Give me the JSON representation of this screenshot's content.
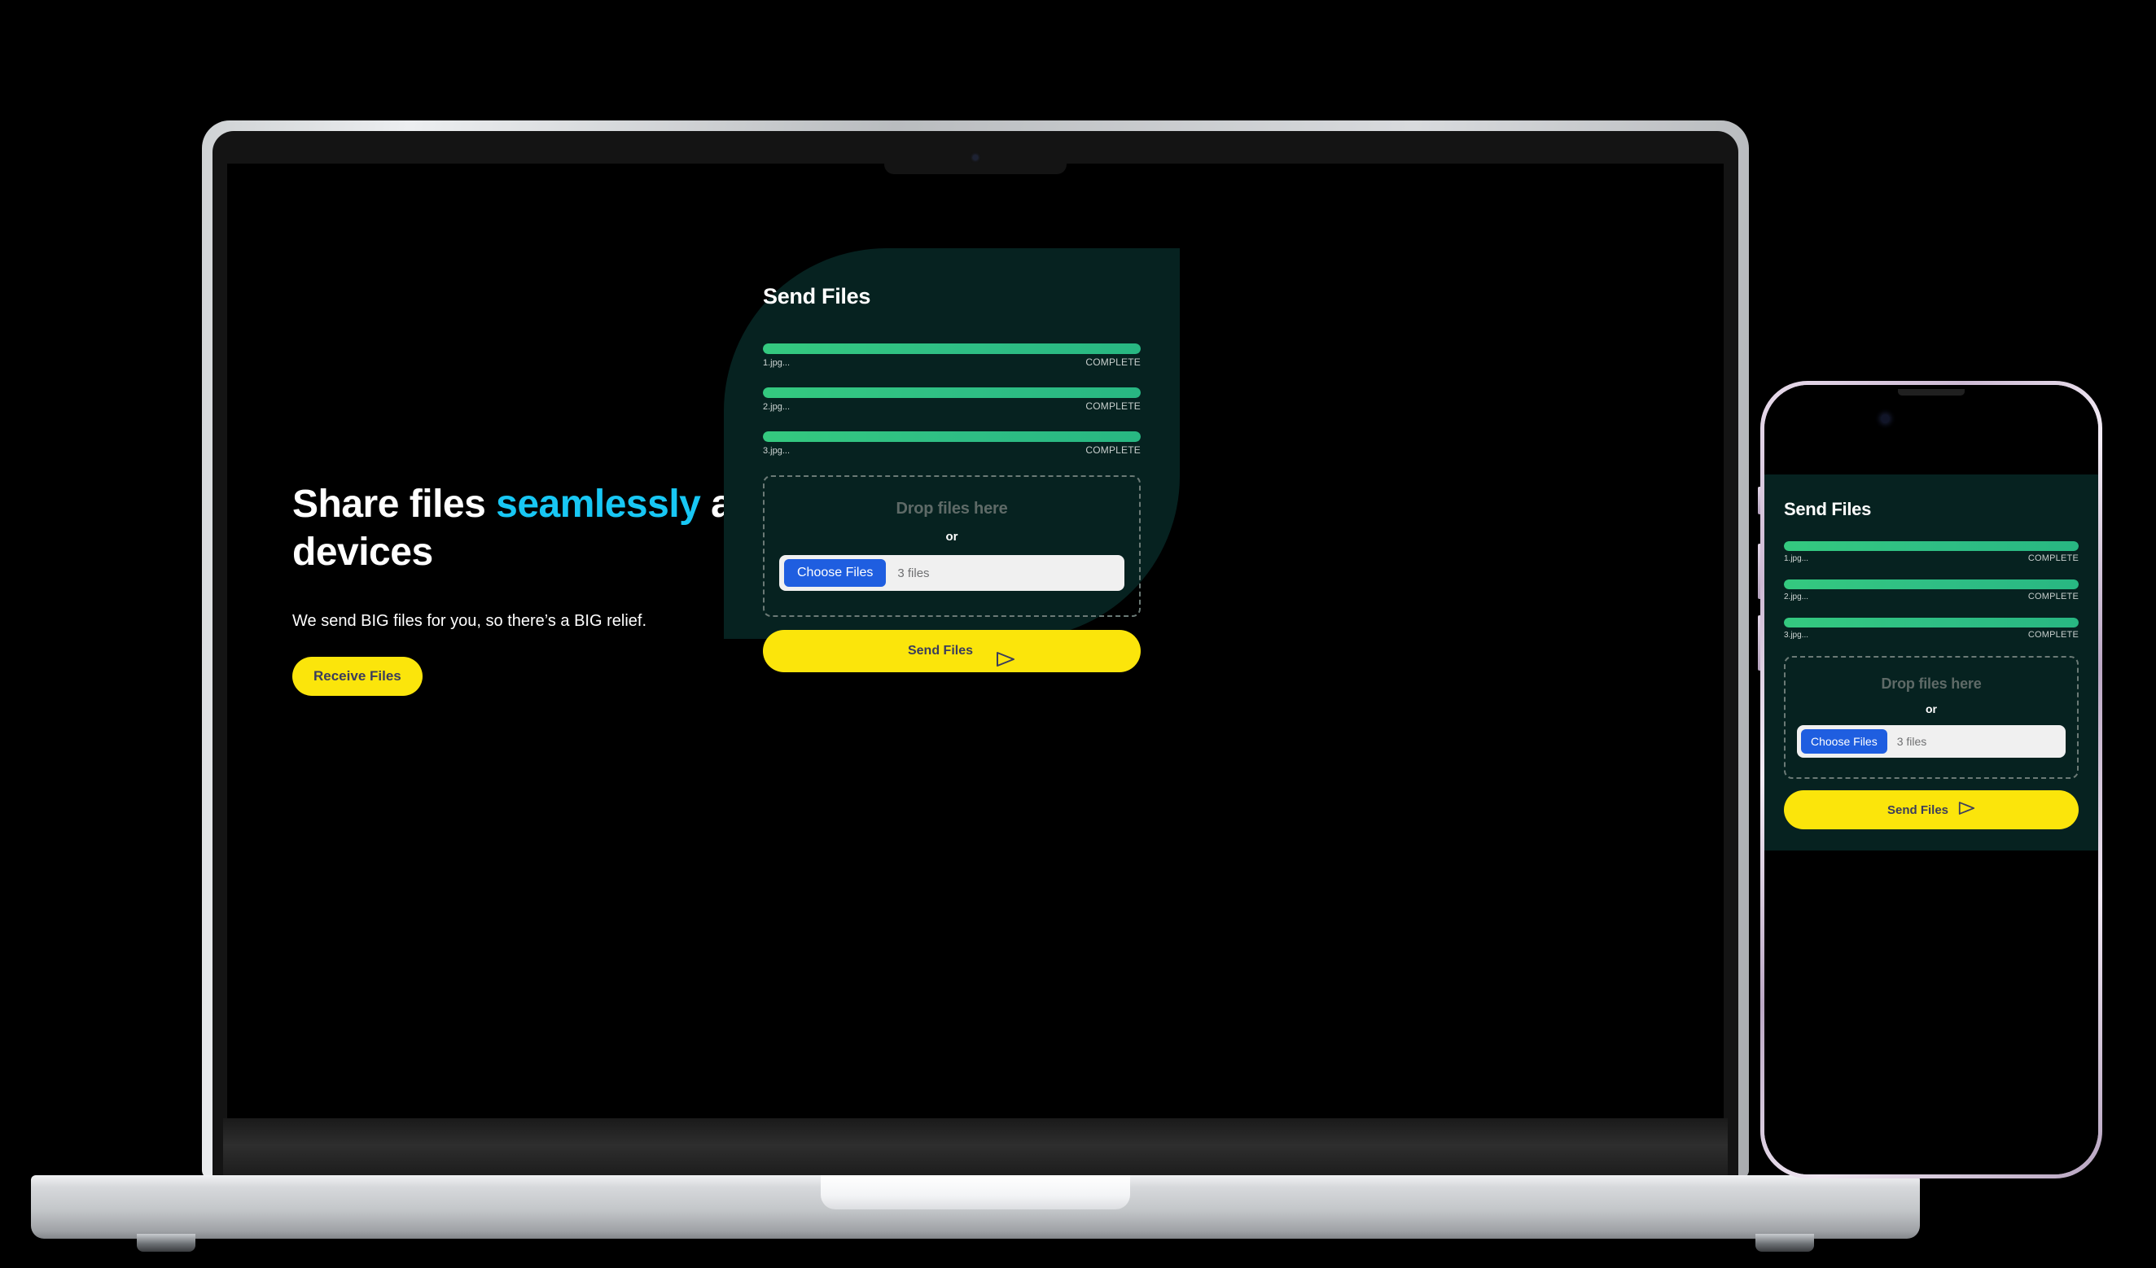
{
  "colors": {
    "background": "#000000",
    "accent_cyan": "#18c7f4",
    "accent_yellow": "#fbe50b",
    "card_green_dark": "#062220",
    "progress_green": "#2fbf84",
    "button_blue": "#1f5ee0",
    "button_text_dark": "#3b3d5c"
  },
  "desktop": {
    "hero": {
      "headline_part1": "Share files ",
      "headline_accent": "seamlessly",
      "headline_part2": " across devices",
      "subtitle": "We send BIG files for you, so there’s a BIG relief.",
      "receive_button_label": "Receive Files"
    },
    "send_card": {
      "title": "Send Files",
      "files": [
        {
          "name": "1.jpg...",
          "status": "COMPLETE",
          "progress": 100
        },
        {
          "name": "2.jpg...",
          "status": "COMPLETE",
          "progress": 100
        },
        {
          "name": "3.jpg...",
          "status": "COMPLETE",
          "progress": 100
        }
      ],
      "dropzone": {
        "drop_label": "Drop files here",
        "or_label": "or",
        "choose_button_label": "Choose Files",
        "file_count_label": "3 files"
      },
      "send_button_label": "Send Files",
      "send_button_icon": "send-triangle-icon"
    }
  },
  "phone": {
    "send_card": {
      "title": "Send Files",
      "files": [
        {
          "name": "1.jpg...",
          "status": "COMPLETE",
          "progress": 100
        },
        {
          "name": "2.jpg...",
          "status": "COMPLETE",
          "progress": 100
        },
        {
          "name": "3.jpg...",
          "status": "COMPLETE",
          "progress": 100
        }
      ],
      "dropzone": {
        "drop_label": "Drop files here",
        "or_label": "or",
        "choose_button_label": "Choose Files",
        "file_count_label": "3 files"
      },
      "send_button_label": "Send Files",
      "send_button_icon": "send-triangle-icon"
    }
  }
}
